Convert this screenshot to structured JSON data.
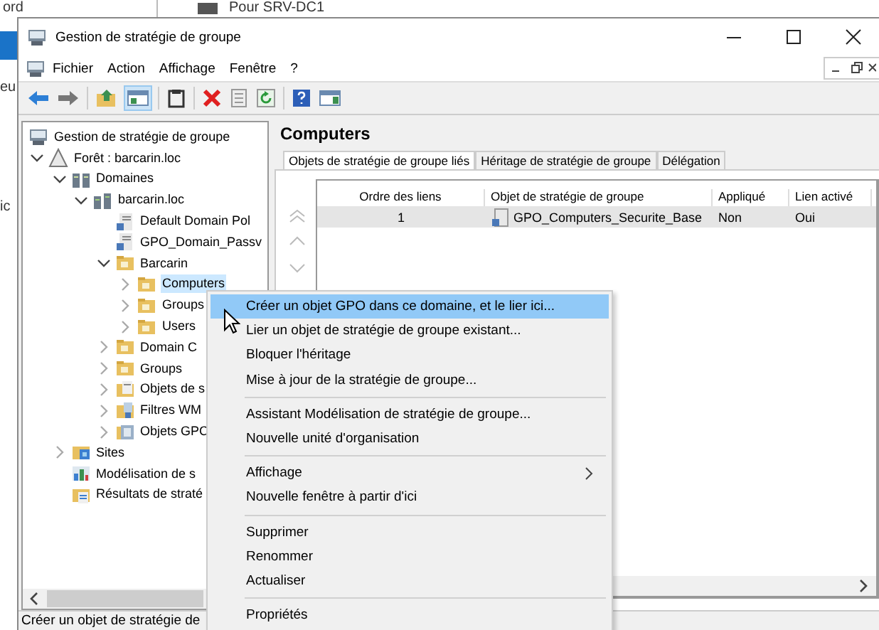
{
  "background_window": {
    "top_texts": [
      "ord",
      "Pour SRV-DC1"
    ],
    "side_texts": [
      "eu",
      "ic"
    ]
  },
  "window": {
    "title": "Gestion de stratégie de groupe"
  },
  "menu_bar": [
    "Fichier",
    "Action",
    "Affichage",
    "Fenêtre",
    "?"
  ],
  "tree": [
    {
      "label": "Gestion de stratégie de groupe",
      "kind": "console",
      "selected": false,
      "children": [
        {
          "label": "Forêt : barcarin.loc",
          "kind": "forest",
          "selected": false,
          "expanded": true,
          "children": [
            {
              "label": "Domaines",
              "kind": "domains",
              "selected": false,
              "expanded": true,
              "children": [
                {
                  "label": "barcarin.loc",
                  "kind": "domain",
                  "selected": false,
                  "expanded": true,
                  "children": [
                    {
                      "label": "Default Domain Pol",
                      "kind": "gpo",
                      "selected": false
                    },
                    {
                      "label": "GPO_Domain_Passv",
                      "kind": "gpo",
                      "selected": false
                    },
                    {
                      "label": "Barcarin",
                      "kind": "ou",
                      "selected": false,
                      "expanded": true,
                      "children": [
                        {
                          "label": "Computers",
                          "kind": "ou",
                          "selected": true,
                          "expanded": false
                        },
                        {
                          "label": "Groups",
                          "kind": "ou",
                          "selected": false,
                          "expanded": false
                        },
                        {
                          "label": "Users",
                          "kind": "ou",
                          "selected": false,
                          "expanded": false
                        }
                      ]
                    },
                    {
                      "label": "Domain C",
                      "kind": "ou",
                      "selected": false,
                      "expanded": false
                    },
                    {
                      "label": "Groups",
                      "kind": "ou",
                      "selected": false,
                      "expanded": false
                    },
                    {
                      "label": "Objets de s",
                      "kind": "gpo-folder",
                      "selected": false,
                      "expanded": false
                    },
                    {
                      "label": "Filtres WM",
                      "kind": "wmi",
                      "selected": false,
                      "expanded": false
                    },
                    {
                      "label": "Objets GPC",
                      "kind": "starter",
                      "selected": false,
                      "expanded": false
                    }
                  ]
                }
              ]
            },
            {
              "label": "Sites",
              "kind": "sites",
              "selected": false,
              "expanded": false
            },
            {
              "label": "Modélisation de s",
              "kind": "modeling",
              "selected": false
            },
            {
              "label": "Résultats de straté",
              "kind": "results",
              "selected": false
            }
          ]
        }
      ]
    }
  ],
  "details": {
    "title": "Computers",
    "tabs": [
      {
        "label": "Objets de stratégie de groupe liés",
        "selected": true
      },
      {
        "label": "Héritage de stratégie de groupe",
        "selected": false
      },
      {
        "label": "Délégation",
        "selected": false
      }
    ],
    "table": {
      "columns": [
        "Ordre des liens",
        "Objet de stratégie de groupe",
        "Appliqué",
        "Lien activé"
      ],
      "rows": [
        {
          "cells": [
            "1",
            "GPO_Computers_Securite_Base",
            "Non",
            "Oui"
          ],
          "selected": true
        }
      ]
    }
  },
  "context_menu": {
    "groups": [
      [
        {
          "label": "Créer un objet GPO dans ce domaine, et le lier ici...",
          "selected": true,
          "submenu": false
        },
        {
          "label": "Lier un objet de stratégie de groupe existant...",
          "selected": false,
          "submenu": false
        },
        {
          "label": "Bloquer l'héritage",
          "selected": false,
          "submenu": false
        },
        {
          "label": "Mise à jour de la stratégie de groupe...",
          "selected": false,
          "submenu": false
        }
      ],
      [
        {
          "label": "Assistant Modélisation de stratégie de groupe...",
          "selected": false,
          "submenu": false
        },
        {
          "label": "Nouvelle unité d'organisation",
          "selected": false,
          "submenu": false
        }
      ],
      [
        {
          "label": "Affichage",
          "selected": false,
          "submenu": true
        },
        {
          "label": "Nouvelle fenêtre à partir d'ici",
          "selected": false,
          "submenu": false
        }
      ],
      [
        {
          "label": "Supprimer",
          "selected": false,
          "submenu": false
        },
        {
          "label": "Renommer",
          "selected": false,
          "submenu": false
        },
        {
          "label": "Actualiser",
          "selected": false,
          "submenu": false
        }
      ],
      [
        {
          "label": "Propriétés",
          "selected": false,
          "submenu": false
        }
      ]
    ]
  },
  "status_bar": "Créer un objet de stratégie de"
}
